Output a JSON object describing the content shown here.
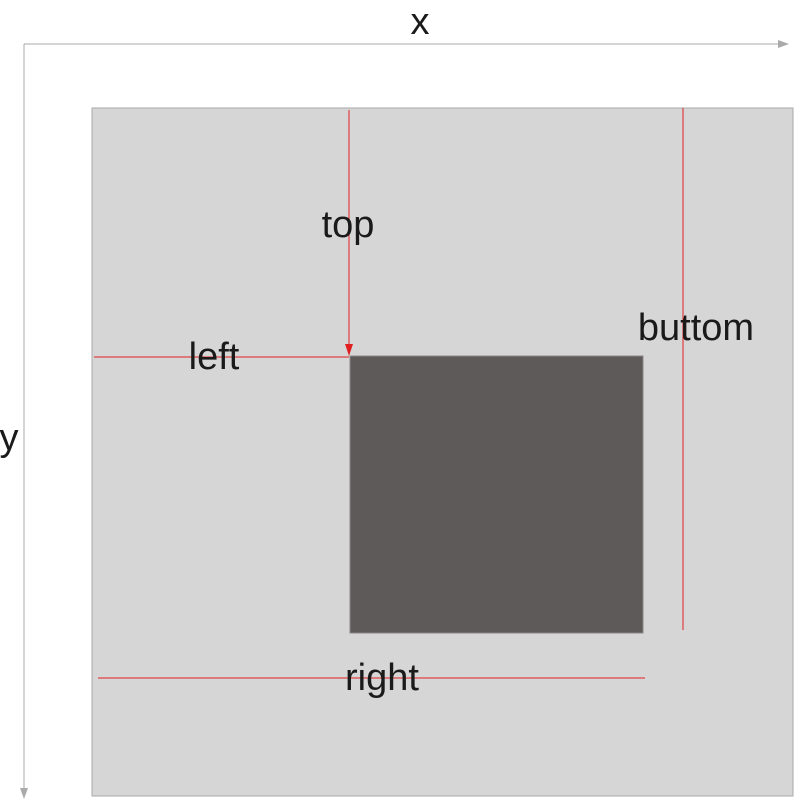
{
  "axes": {
    "x_label": "x",
    "y_label": "y"
  },
  "measures": {
    "top": "top",
    "left": "left",
    "bottom": "buttom",
    "right": "right"
  },
  "colors": {
    "axis": "#aaaaaa",
    "container": "#d6d6d6",
    "inner_box": "#5f5a5a",
    "measure_line": "#e02020",
    "text": "#1a1a1a"
  }
}
